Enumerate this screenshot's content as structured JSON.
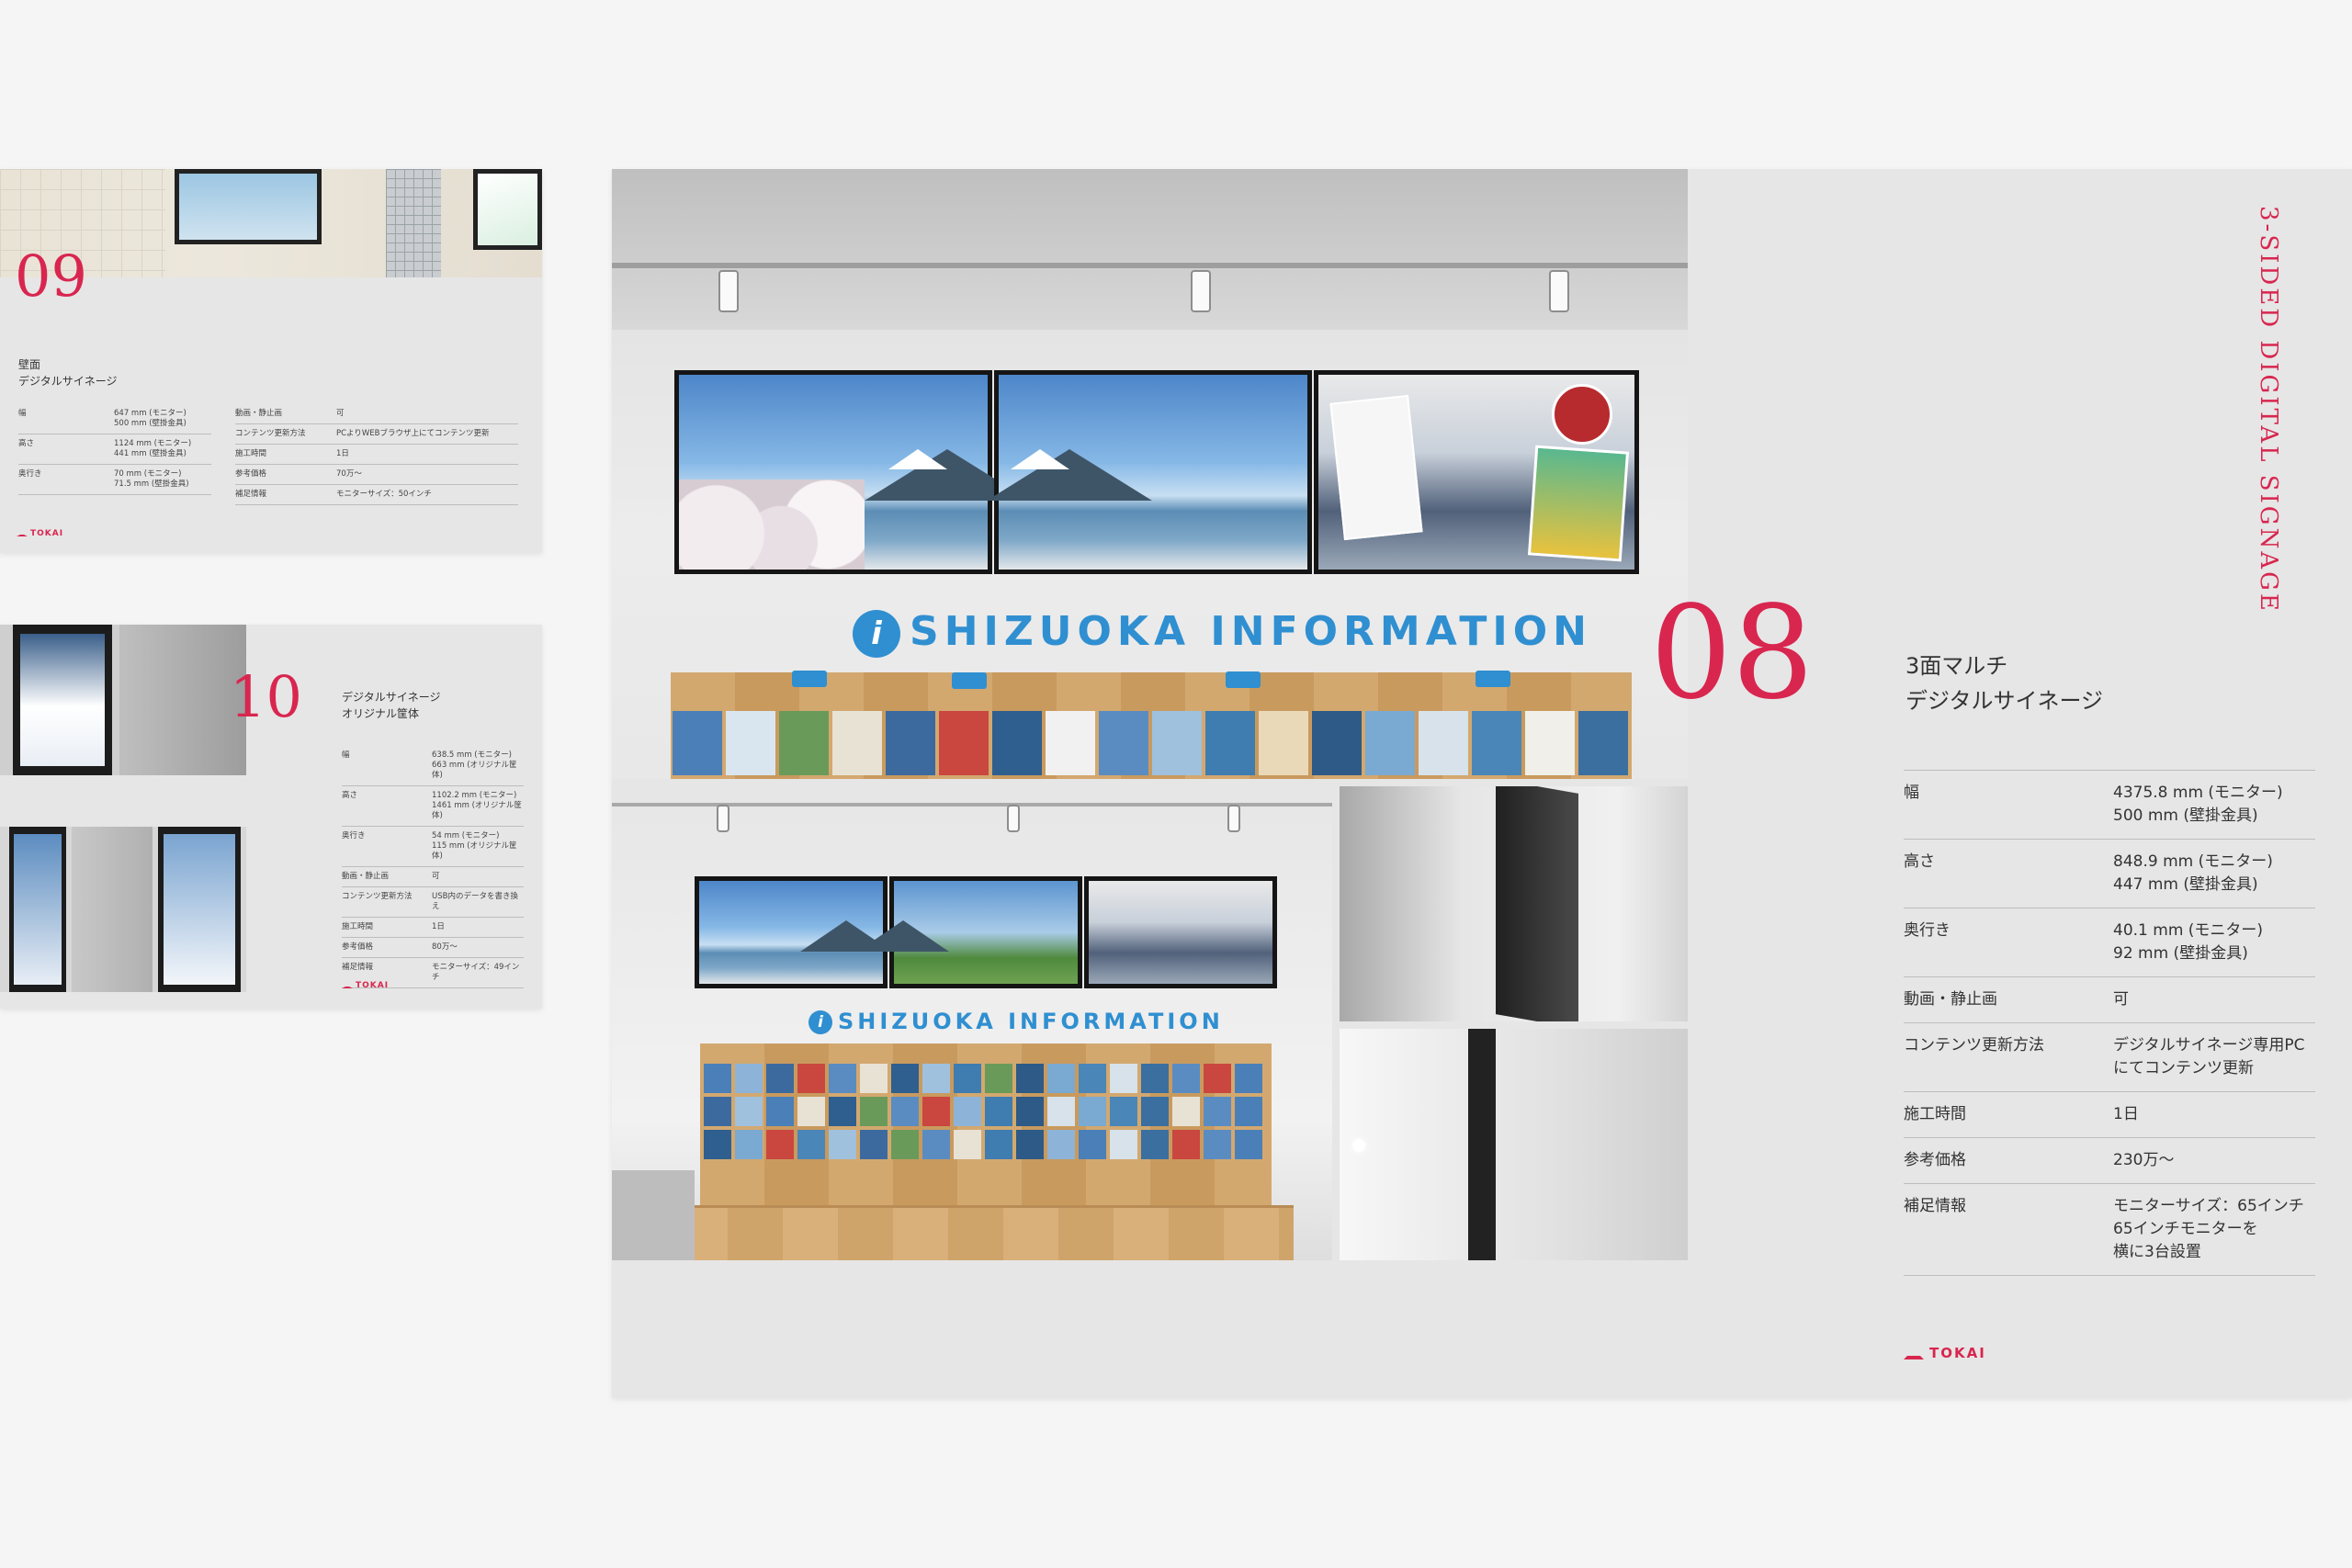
{
  "card09": {
    "number": "09",
    "title_line1": "壁面",
    "title_line2": "デジタルサイネージ",
    "specs_left": [
      {
        "label": "幅",
        "value": "647 mm (モニター)\n500 mm (壁掛金具)"
      },
      {
        "label": "高さ",
        "value": "1124 mm (モニター)\n441 mm (壁掛金具)"
      },
      {
        "label": "奥行き",
        "value": "70 mm (モニター)\n71.5 mm (壁掛金具)"
      }
    ],
    "specs_right": [
      {
        "label": "動画・静止画",
        "value": "可"
      },
      {
        "label": "コンテンツ更新方法",
        "value": "PCよりWEBブラウザ上にてコンテンツ更新"
      },
      {
        "label": "施工時間",
        "value": "1日"
      },
      {
        "label": "参考価格",
        "value": "70万〜"
      },
      {
        "label": "補足情報",
        "value": "モニターサイズ：50インチ"
      }
    ],
    "logo": "TOKAI"
  },
  "card10": {
    "number": "10",
    "title_line1": "デジタルサイネージ",
    "title_line2": "オリジナル筐体",
    "specs": [
      {
        "label": "幅",
        "value": "638.5 mm (モニター)\n663 mm (オリジナル筐体)"
      },
      {
        "label": "高さ",
        "value": "1102.2 mm (モニター)\n1461 mm (オリジナル筐体)"
      },
      {
        "label": "奥行き",
        "value": "54 mm (モニター)\n115 mm (オリジナル筐体)"
      },
      {
        "label": "動画・静止画",
        "value": "可"
      },
      {
        "label": "コンテンツ更新方法",
        "value": "USB内のデータを書き換え"
      },
      {
        "label": "施工時間",
        "value": "1日"
      },
      {
        "label": "参考価格",
        "value": "80万〜"
      },
      {
        "label": "補足情報",
        "value": "モニターサイズ：49インチ"
      }
    ],
    "logo": "TOKAI"
  },
  "spread08": {
    "number": "08",
    "vertical_title": "3-SIDED DIGITAL SIGNAGE",
    "title_line1": "3面マルチ",
    "title_line2": "デジタルサイネージ",
    "sign_text": "SHIZUOKA INFORMATION",
    "sign_icon": "i",
    "specs": [
      {
        "label": "幅",
        "value": "4375.8 mm (モニター)\n500 mm (壁掛金具)"
      },
      {
        "label": "高さ",
        "value": "848.9 mm (モニター)\n447 mm (壁掛金具)"
      },
      {
        "label": "奥行き",
        "value": "40.1 mm (モニター)\n92 mm (壁掛金具)"
      },
      {
        "label": "動画・静止画",
        "value": "可"
      },
      {
        "label": "コンテンツ更新方法",
        "value": "デジタルサイネージ専用PC\nにてコンテンツ更新"
      },
      {
        "label": "施工時間",
        "value": "1日"
      },
      {
        "label": "参考価格",
        "value": "230万〜"
      },
      {
        "label": "補足情報",
        "value": "モニターサイズ：65インチ\n65インチモニターを\n横に3台設置"
      }
    ],
    "logo": "TOKAI"
  }
}
